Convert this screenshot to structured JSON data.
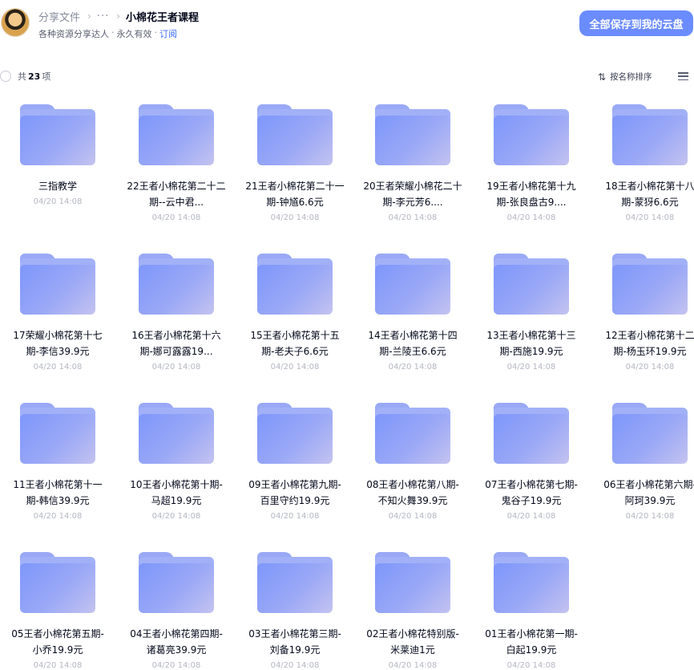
{
  "header": {
    "breadcrumb_root": "分享文件",
    "breadcrumb_more": "···",
    "breadcrumb_current": "小棉花王者课程",
    "sharer": "各种资源分享达人",
    "validity": "永久有效",
    "subscribe": "订阅",
    "save_all": "全部保存到我的云盘"
  },
  "toolbar": {
    "count_prefix": "共",
    "count": "23",
    "count_suffix": "项",
    "sort_label": "按名称排序"
  },
  "items": [
    {
      "name": "三指教学",
      "date": "04/20 14:08"
    },
    {
      "name": "22王者小棉花第二十二期--云中君...",
      "date": "04/20 14:08"
    },
    {
      "name": "21王者小棉花第二十一期-钟馗6.6元",
      "date": "04/20 14:08"
    },
    {
      "name": "20王者荣耀小棉花二十期-李元芳6....",
      "date": "04/20 14:08"
    },
    {
      "name": "19王者小棉花第十九期-张良盘古9....",
      "date": "04/20 14:08"
    },
    {
      "name": "18王者小棉花第十八期-蒙犽6.6元",
      "date": "04/20 14:08"
    },
    {
      "name": "17荣耀小棉花第十七期-李信39.9元",
      "date": "04/20 14:08"
    },
    {
      "name": "16王者小棉花第十六期-娜可露露19...",
      "date": "04/20 14:08"
    },
    {
      "name": "15王者小棉花第十五期-老夫子6.6元",
      "date": "04/20 14:08"
    },
    {
      "name": "14王者小棉花第十四期-兰陵王6.6元",
      "date": "04/20 14:08"
    },
    {
      "name": "13王者小棉花第十三期-西施19.9元",
      "date": "04/20 14:08"
    },
    {
      "name": "12王者小棉花第十二期-杨玉环19.9元",
      "date": "04/20 14:08"
    },
    {
      "name": "11王者小棉花第十一期-韩信39.9元",
      "date": "04/20 14:08"
    },
    {
      "name": "10王者小棉花第十期-马超19.9元",
      "date": "04/20 14:08"
    },
    {
      "name": "09王者小棉花第九期-百里守约19.9元",
      "date": "04/20 14:08"
    },
    {
      "name": "08王者小棉花第八期-不知火舞39.9元",
      "date": "04/20 14:08"
    },
    {
      "name": "07王者小棉花第七期-鬼谷子19.9元",
      "date": "04/20 14:08"
    },
    {
      "name": "06王者小棉花第六期-阿珂39.9元",
      "date": "04/20 14:08"
    },
    {
      "name": "05王者小棉花第五期-小乔19.9元",
      "date": "04/20 14:08"
    },
    {
      "name": "04王者小棉花第四期-诸葛亮39.9元",
      "date": "04/20 14:08"
    },
    {
      "name": "03王者小棉花第三期-刘备19.9元",
      "date": "04/20 14:08"
    },
    {
      "name": "02王者小棉花特别版-米莱迪1元",
      "date": "04/20 14:08"
    },
    {
      "name": "01王者小棉花第一期-白起19.9元",
      "date": "04/20 14:08"
    }
  ]
}
